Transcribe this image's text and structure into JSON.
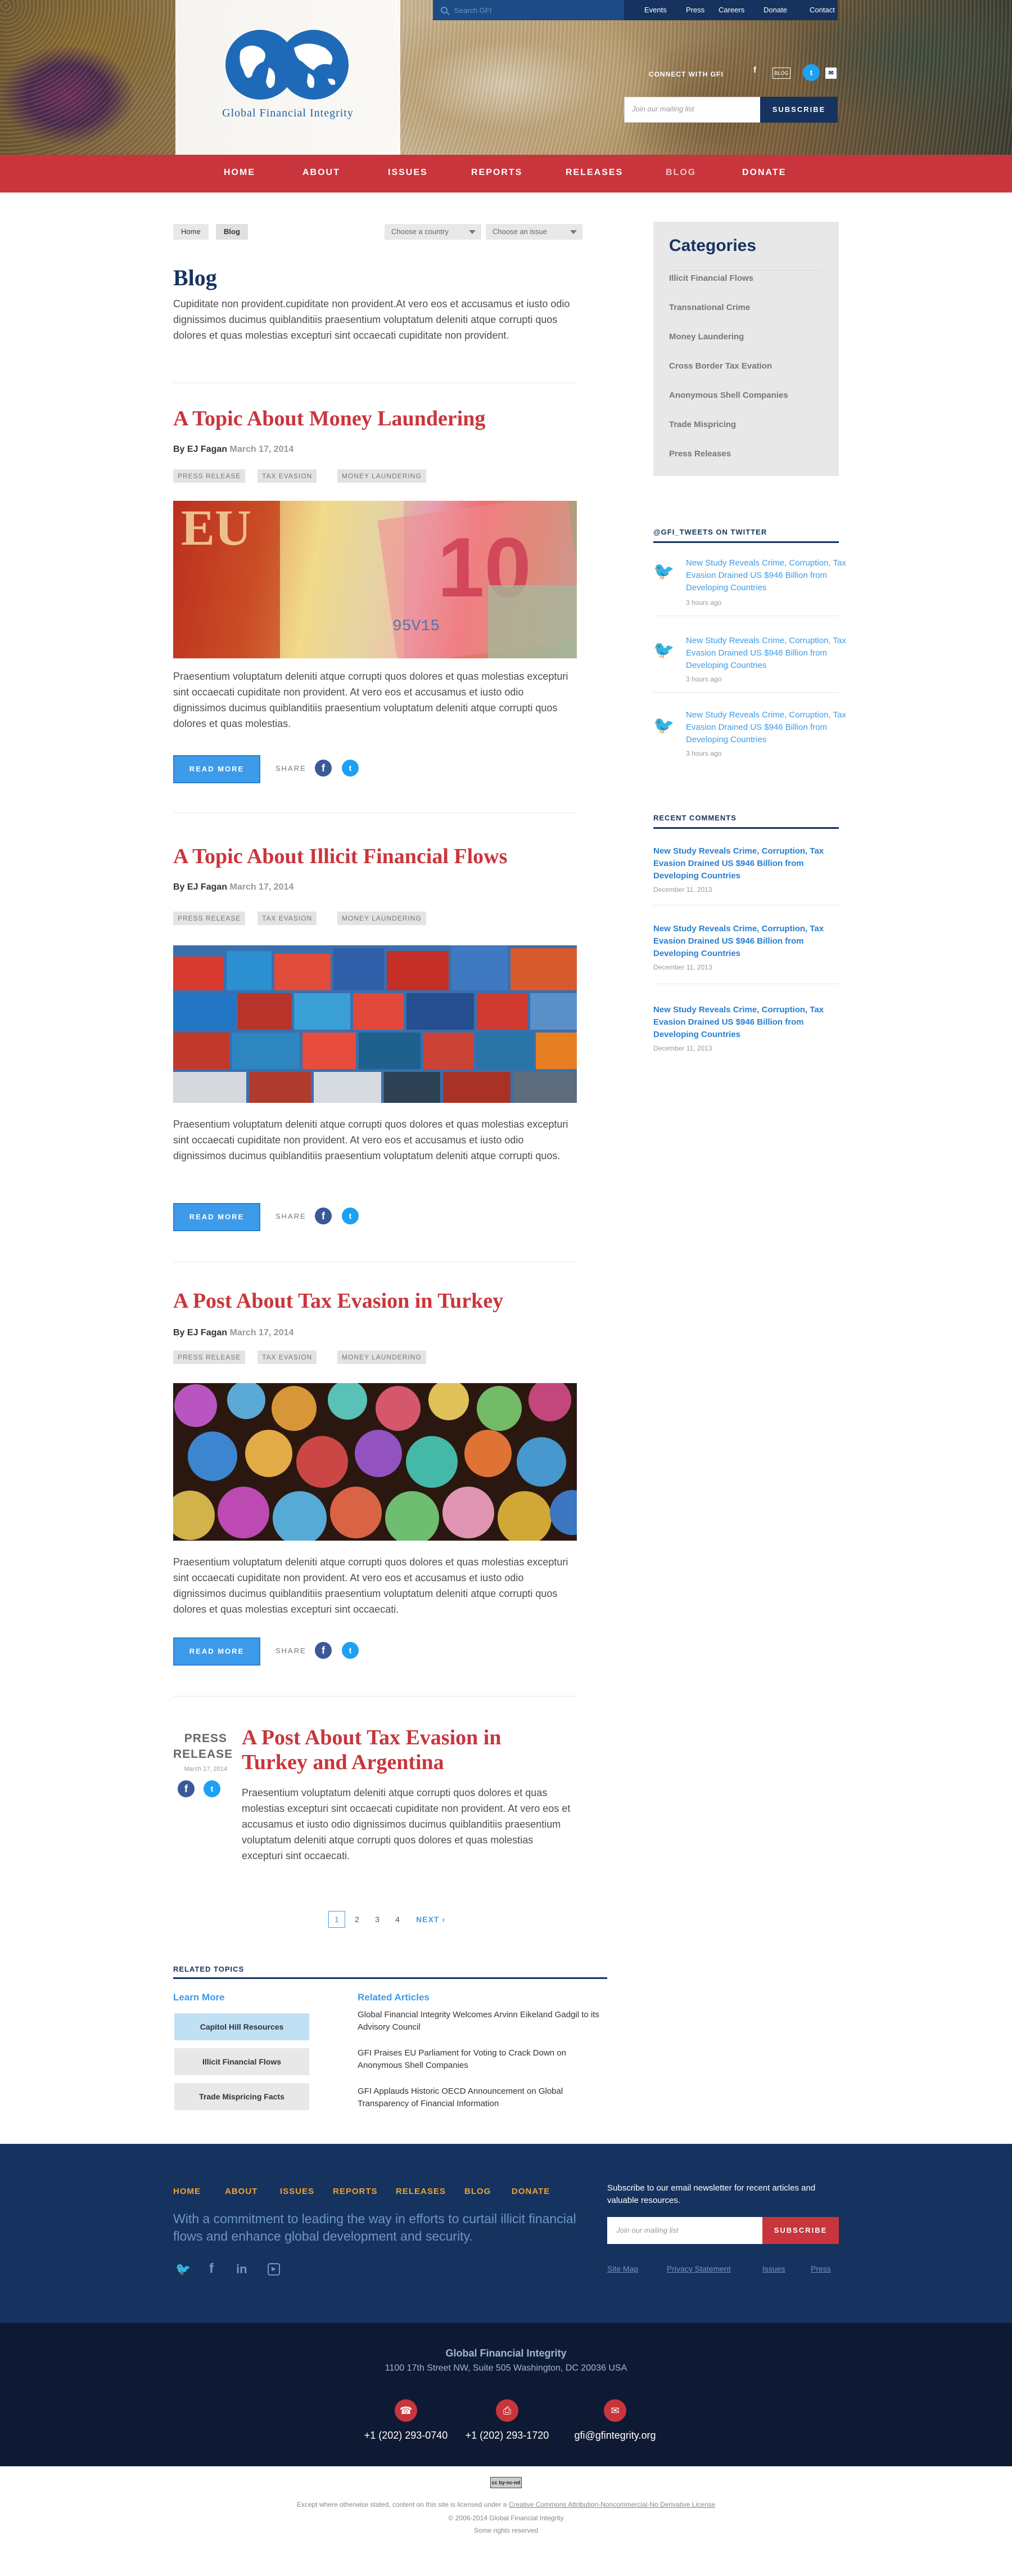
{
  "header": {
    "search_placeholder": "Search GFI",
    "top_links": [
      "Events",
      "Press",
      "Careers",
      "Donate",
      "Contact"
    ],
    "logo_text": "Global Financial Integrity",
    "connect_label": "CONNECT WITH GFI",
    "mailing_placeholder": "Join our mailing list",
    "subscribe_label": "SUBSCRIBE"
  },
  "nav": [
    "HOME",
    "ABOUT",
    "ISSUES",
    "REPORTS",
    "RELEASES",
    "BLOG",
    "DONATE"
  ],
  "breadcrumb": [
    "Home",
    "Blog"
  ],
  "filters": {
    "country": "Choose a country",
    "issue": "Choose an issue"
  },
  "page": {
    "title": "Blog",
    "intro": "Cupiditate non provident.cupiditate non provident.At vero eos et accusamus et iusto odio dignissimos ducimus quiblanditiis praesentium voluptatum deleniti atque corrupti quos dolores et quas molestias excepturi sint occaecati cupiditate non provident."
  },
  "posts": [
    {
      "title": "A Topic About Money Laundering",
      "by": "By EJ Fagan",
      "date": "March 17, 2014",
      "tags": [
        "PRESS RELEASE",
        "TAX EVASION",
        "MONEY LAUNDERING"
      ],
      "body": "Praesentium voluptatum deleniti atque corrupti quos dolores et quas molestias excepturi sint occaecati cupiditate non provident. At vero eos et accusamus et iusto odio dignissimos ducimus quiblanditiis praesentium voluptatum deleniti atque corrupti quos dolores et quas molestias.",
      "read_more": "READ MORE",
      "share": "SHARE"
    },
    {
      "title": "A Topic About Illicit Financial Flows",
      "by": "By EJ Fagan",
      "date": "March 17, 2014",
      "tags": [
        "PRESS RELEASE",
        "TAX EVASION",
        "MONEY LAUNDERING"
      ],
      "body": "Praesentium voluptatum deleniti atque corrupti quos dolores et quas molestias excepturi sint occaecati cupiditate non provident. At vero eos et accusamus et iusto odio dignissimos ducimus quiblanditiis praesentium voluptatum deleniti atque corrupti quos.",
      "read_more": "READ MORE",
      "share": "SHARE"
    },
    {
      "title": "A Post About Tax Evasion in Turkey",
      "by": "By EJ Fagan",
      "date": "March 17, 2014",
      "tags": [
        "PRESS RELEASE",
        "TAX EVASION",
        "MONEY LAUNDERING"
      ],
      "body": "Praesentium voluptatum deleniti atque corrupti quos dolores et quas molestias excepturi sint occaecati cupiditate non provident. At vero eos et accusamus et iusto odio dignissimos ducimus quiblanditiis praesentium voluptatum deleniti atque corrupti quos dolores et quas molestias excepturi sint occaecati.",
      "read_more": "READ MORE",
      "share": "SHARE"
    }
  ],
  "press_post": {
    "label1": "PRESS",
    "label2": "RELEASE",
    "date": "March 17, 2014",
    "title_line1": "A Post About Tax Evasion in",
    "title_line2": "Turkey and Argentina",
    "body": "Praesentium voluptatum deleniti atque corrupti quos dolores et quas molestias excepturi sint occaecati cupiditate non provident. At vero eos et accusamus et iusto odio dignissimos ducimus quiblanditiis praesentium voluptatum deleniti atque corrupti quos dolores et quas molestias excepturi sint occaecati."
  },
  "pagination": {
    "pages": [
      "1",
      "2",
      "3",
      "4"
    ],
    "next": "NEXT ›"
  },
  "sidebar": {
    "categories_title": "Categories",
    "categories": [
      "Illicit Financial Flows",
      "Transnational Crime",
      "Money Laundering",
      "Cross Border Tax Evation",
      "Anonymous Shell Companies",
      "Trade Mispricing",
      "Press Releases"
    ],
    "tweets_title": "@GFI_TWEETS ON TWITTER",
    "tweets": [
      {
        "text": "New Study Reveals Crime, Corruption, Tax Evasion Drained US $946 Billion from Developing Countries",
        "ago": "3 hours ago"
      },
      {
        "text": "New Study Reveals Crime, Corruption, Tax Evasion Drained US $946 Billion from Developing Countries",
        "ago": "3 hours ago"
      },
      {
        "text": "New Study Reveals Crime, Corruption, Tax Evasion Drained US $946 Billion from Developing Countries",
        "ago": "3 hours ago"
      }
    ],
    "comments_title": "RECENT COMMENTS",
    "comments": [
      {
        "text": "New Study Reveals Crime, Corruption, Tax Evasion Drained US $946 Billion from Developing Countries",
        "date": "December 11, 2013"
      },
      {
        "text": "New Study Reveals Crime, Corruption, Tax Evasion Drained US $946 Billion from Developing Countries",
        "date": "December 11, 2013"
      },
      {
        "text": "New Study Reveals Crime, Corruption, Tax Evasion Drained US $946 Billion from Developing Countries",
        "date": "December 11, 2013"
      }
    ]
  },
  "related": {
    "heading": "RELATED TOPICS",
    "learn_more": "Learn More",
    "buttons": [
      "Capitol Hill Resources",
      "Illicit Financial Flows",
      "Trade Mispricing Facts"
    ],
    "articles_heading": "Related Articles",
    "articles": [
      "Global Financial Integrity Welcomes Arvinn Eikeland Gadgil to its Advisory Council",
      "GFI Praises EU Parliament for Voting to Crack Down on Anonymous Shell Companies",
      "GFI Applauds Historic OECD Announcement on Global Transparency of Financial Information"
    ]
  },
  "footer": {
    "nav": [
      "HOME",
      "ABOUT",
      "ISSUES",
      "REPORTS",
      "RELEASES",
      "BLOG",
      "DONATE"
    ],
    "tagline": "With a commitment to leading the way in efforts to curtail illicit financial flows and enhance global development and security.",
    "subscribe_text": "Subscribe to our email newsletter for recent articles and valuable resources.",
    "mailing_placeholder": "Join our mailing list",
    "subscribe_label": "SUBSCRIBE",
    "links": [
      "Site Map",
      "Privacy Statement",
      "Issues",
      "Press"
    ],
    "org": "Global Financial Integrity",
    "address": "1100 17th Street NW, Suite 505 Washington, DC 20036 USA",
    "phone": "+1 (202) 293-0740",
    "fax": "+1 (202) 293-1720",
    "email": "gfi@gfintegrity.org",
    "license_pre": "Except where otherwise stated, content on this site is licensed under a ",
    "license_link": "Creative Commons Attribution-Noncommercial-No Derivative License",
    "copyright": "© 2006-2014 Global Financial Integrity",
    "rights": "Some rights reserved",
    "cc_badge": "cc by-nc-nd"
  },
  "colors": {
    "navy": "#15335e",
    "red": "#c9353c",
    "blue": "#3d9be9",
    "gold": "#f2a22e"
  }
}
